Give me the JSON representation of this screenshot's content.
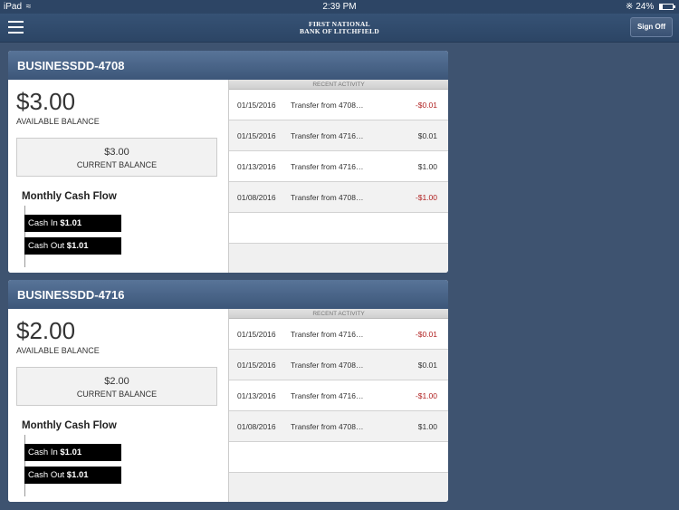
{
  "status_bar": {
    "device": "iPad",
    "time": "2:39 PM",
    "battery": "24%",
    "battery_level": 0.24
  },
  "nav": {
    "bank_name_line1": "FIRST NATIONAL",
    "bank_name_line2": "BANK OF LITCHFIELD",
    "sign_off_label": "Sign Off"
  },
  "accounts": [
    {
      "name": "BUSINESSDD-4708",
      "available_balance": "$3.00",
      "available_label": "AVAILABLE BALANCE",
      "current_balance": "$3.00",
      "current_label": "CURRENT BALANCE",
      "cash_flow_title": "Monthly Cash Flow",
      "cash_in_label": "Cash In",
      "cash_in_value": "$1.01",
      "cash_out_label": "Cash Out",
      "cash_out_value": "$1.01",
      "recent_activity_label": "RECENT ACTIVITY",
      "transactions": [
        {
          "date": "01/15/2016",
          "description": "Transfer from 4708…",
          "amount": "-$0.01"
        },
        {
          "date": "01/15/2016",
          "description": "Transfer from 4716…",
          "amount": "$0.01"
        },
        {
          "date": "01/13/2016",
          "description": "Transfer from 4716…",
          "amount": "$1.00"
        },
        {
          "date": "01/08/2016",
          "description": "Transfer from 4708…",
          "amount": "-$1.00"
        }
      ]
    },
    {
      "name": "BUSINESSDD-4716",
      "available_balance": "$2.00",
      "available_label": "AVAILABLE BALANCE",
      "current_balance": "$2.00",
      "current_label": "CURRENT BALANCE",
      "cash_flow_title": "Monthly Cash Flow",
      "cash_in_label": "Cash In",
      "cash_in_value": "$1.01",
      "cash_out_label": "Cash Out",
      "cash_out_value": "$1.01",
      "recent_activity_label": "RECENT ACTIVITY",
      "transactions": [
        {
          "date": "01/15/2016",
          "description": "Transfer from 4716…",
          "amount": "-$0.01"
        },
        {
          "date": "01/15/2016",
          "description": "Transfer from 4708…",
          "amount": "$0.01"
        },
        {
          "date": "01/13/2016",
          "description": "Transfer from 4716…",
          "amount": "-$1.00"
        },
        {
          "date": "01/08/2016",
          "description": "Transfer from 4708…",
          "amount": "$1.00"
        }
      ]
    }
  ]
}
